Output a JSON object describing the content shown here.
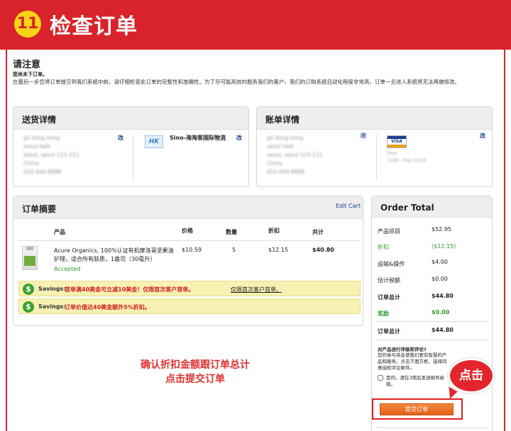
{
  "banner": {
    "step": "11",
    "title": "检查订单"
  },
  "notice": {
    "title": "请注意",
    "subtitle": "您尚未下订单。",
    "text": "在最后一步您将订单提交到我们系统中前，请仔细检查此订单的完整性和准确性。为了尽可能高效的服务我们的客户，我们的订购系统自动化程度非常高，订单一旦进入系统将无法再做修改。"
  },
  "shipping": {
    "title": "送货详情",
    "address": [
      "gil dong hong",
      "seoul heik",
      "seoul, seoul 123-111",
      "China",
      "010-444-8888"
    ],
    "edit_label": "改",
    "carrier_logo": "HK",
    "carrier_name": "Sino-海淘客国际物流",
    "carrier_edit_label": "改"
  },
  "billing": {
    "title": "账单详情",
    "address": [
      "gil dong hong",
      "seoul heik",
      "seoul, seoul 123-111",
      "China",
      "010-444-8888"
    ],
    "edit_label": "改",
    "card_brand": "VISA",
    "card_lines": [
      "Visa",
      "1199 - Exp 12/15"
    ],
    "card_edit_label": "改"
  },
  "summary": {
    "title": "订单摘要",
    "edit_cart": "Edit Cart",
    "headers": {
      "product": "产品",
      "price": "价格",
      "qty": "数量",
      "discount": "折扣",
      "total": "共计"
    },
    "item": {
      "name": "Acure Organics, 100%认证有机摩洛哥坚果油护理，适合所有肤质，1盎司（30毫升）",
      "status": "Accepted",
      "price": "$10.59",
      "qty": "5",
      "discount": "$12.15",
      "total": "$40.80"
    },
    "savings": [
      {
        "label": "Savings:",
        "text": "首单满40美金可立减10美金！仅限首次客户首单。",
        "link": "仅限首次客户首单。"
      },
      {
        "label": "Savings:",
        "text": "订单价值达40美金额外5%折扣。"
      }
    ]
  },
  "order_total": {
    "title": "Order Total",
    "rows": [
      {
        "label": "产品项目",
        "value": "$52.95"
      },
      {
        "label": "折扣",
        "value": "($12.15)"
      },
      {
        "label": "运输&操作",
        "value": "$4.00"
      },
      {
        "label": "估计税额",
        "value": "$0.00"
      },
      {
        "label": "订单总计",
        "value": "$44.80"
      },
      {
        "label": "奖励",
        "value": "$0.00"
      },
      {
        "label": "订单总计",
        "value": "$44.80"
      }
    ],
    "review_title": "对产品进行评级和评论?",
    "review_text": "您的参与将会使我们更有智慧的产品和服务。点击下面方框，选择同意授权评论邮件。",
    "review_checkbox": "是的。请在3周后发送邮件给我。",
    "submit": "提交订单"
  },
  "callout": {
    "line1": "确认折扣金额跟订单总计",
    "line2": "点击提交订单"
  },
  "bubble": "点击",
  "colors": {
    "banner": "#d8232a",
    "accent_orange": "#e0601a",
    "green": "#2e9a2e",
    "red": "#d02020",
    "link": "#1a3d8f"
  }
}
